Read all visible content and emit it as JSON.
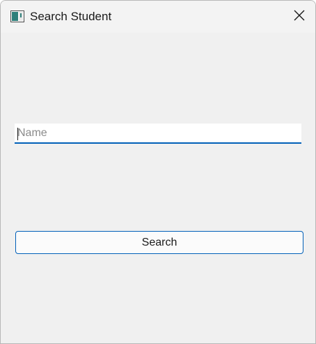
{
  "window": {
    "title": "Search Student",
    "app_icon": "window-app-icon",
    "close_icon": "close-icon"
  },
  "form": {
    "name_input": {
      "value": "",
      "placeholder": "Name"
    },
    "search_button_label": "Search"
  },
  "colors": {
    "accent": "#005fb8",
    "background": "#f0f0f0",
    "titlebar": "#f3f3f3"
  }
}
